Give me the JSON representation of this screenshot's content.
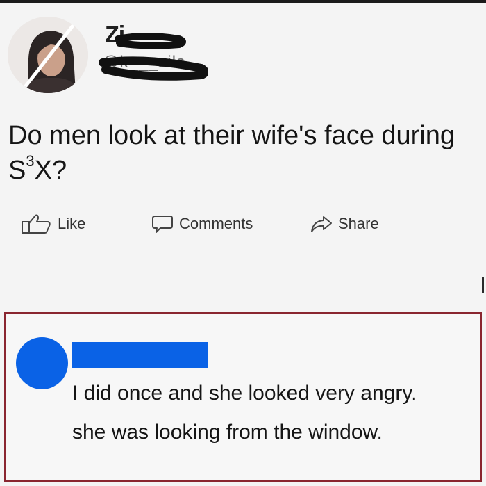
{
  "post": {
    "username": "Zi",
    "handle": "@k___zils",
    "text_line1": "Do men look at their wife's face during",
    "text_line2_base": "S",
    "text_line2_sup": "3",
    "text_line2_rest": "X?"
  },
  "actions": {
    "like_label": "Like",
    "comments_label": "Comments",
    "share_label": "Share"
  },
  "comment": {
    "line1": "I did once and she looked very angry.",
    "line2": "she was looking from the window."
  },
  "colors": {
    "highlight_border": "#8a2630",
    "redaction_blue": "#0a62e6",
    "scribble": "#111111"
  },
  "icons": [
    "thumbs-up-icon",
    "comment-bubble-icon",
    "share-arrow-icon"
  ]
}
